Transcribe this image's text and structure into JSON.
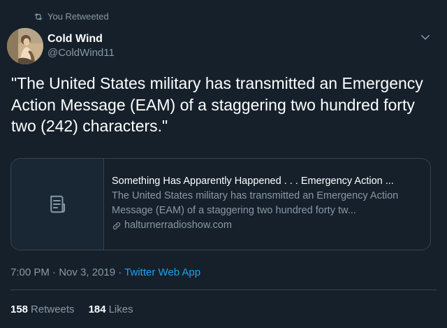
{
  "retweet_context": {
    "label": "You Retweeted"
  },
  "author": {
    "display_name": "Cold Wind",
    "handle": "@ColdWind11"
  },
  "tweet": {
    "text": "\"The United States military has transmitted an Emergency Action Message (EAM) of a staggering two hundred forty two (242) characters.\""
  },
  "link_card": {
    "title": "Something Has Apparently Happened . . . Emergency Action ...",
    "description": "The United States military has transmitted an Emergency Action Message (EAM) of a staggering two hundred forty tw...",
    "domain": "halturnerradioshow.com",
    "thumbnail_icon": "document-icon"
  },
  "meta": {
    "time": "7:00 PM",
    "separator1": " · ",
    "date": "Nov 3, 2019",
    "separator2": " · ",
    "source": "Twitter Web App"
  },
  "stats": {
    "retweets_count": "158",
    "retweets_label": "Retweets",
    "likes_count": "184",
    "likes_label": "Likes"
  },
  "colors": {
    "background": "#15202b",
    "secondary_text": "#8899a6",
    "accent": "#1da1f2",
    "border": "#38444d"
  }
}
